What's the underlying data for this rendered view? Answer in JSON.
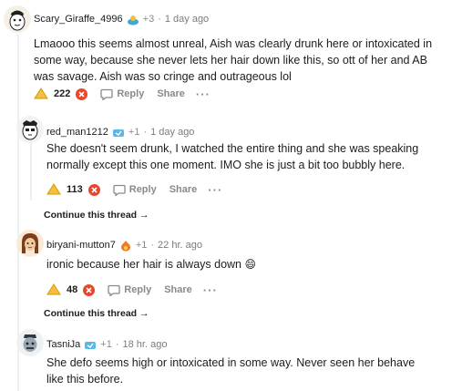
{
  "comments": [
    {
      "username": "Scary_Giraffe_4996",
      "award_count": "+3",
      "time": "1 day ago",
      "body": "Lmaooo this seems almost unreal, Aish was clearly drunk here or intoxicated in some way, because she never lets her hair down like this, so ott of her and AB was savage. Aish was so cringe and outrageous lol",
      "score": "222",
      "reply_label": "Reply",
      "share_label": "Share",
      "more_label": "···"
    },
    {
      "username": "red_man1212",
      "award_count": "+1",
      "time": "1 day ago",
      "body": "She doesn't seem drunk, I watched the entire thing and she was speaking normally except this one moment. IMO she is just a bit too bubbly here.",
      "score": "113",
      "reply_label": "Reply",
      "share_label": "Share",
      "more_label": "···"
    },
    {
      "username": "biryani-mutton7",
      "award_count": "+1",
      "time": "22 hr. ago",
      "body": "ironic because her hair is always down",
      "score": "48",
      "reply_label": "Reply",
      "share_label": "Share",
      "more_label": "···"
    },
    {
      "username": "TasniJa",
      "award_count": "+1",
      "time": "18 hr. ago",
      "body": "She defo seems high or intoxicated in some way. Never seen her behave like this before."
    }
  ],
  "continue_thread_1": "Continue this thread →",
  "continue_thread_2": "Continue this thread →",
  "separator": "·",
  "emoji": "😄"
}
